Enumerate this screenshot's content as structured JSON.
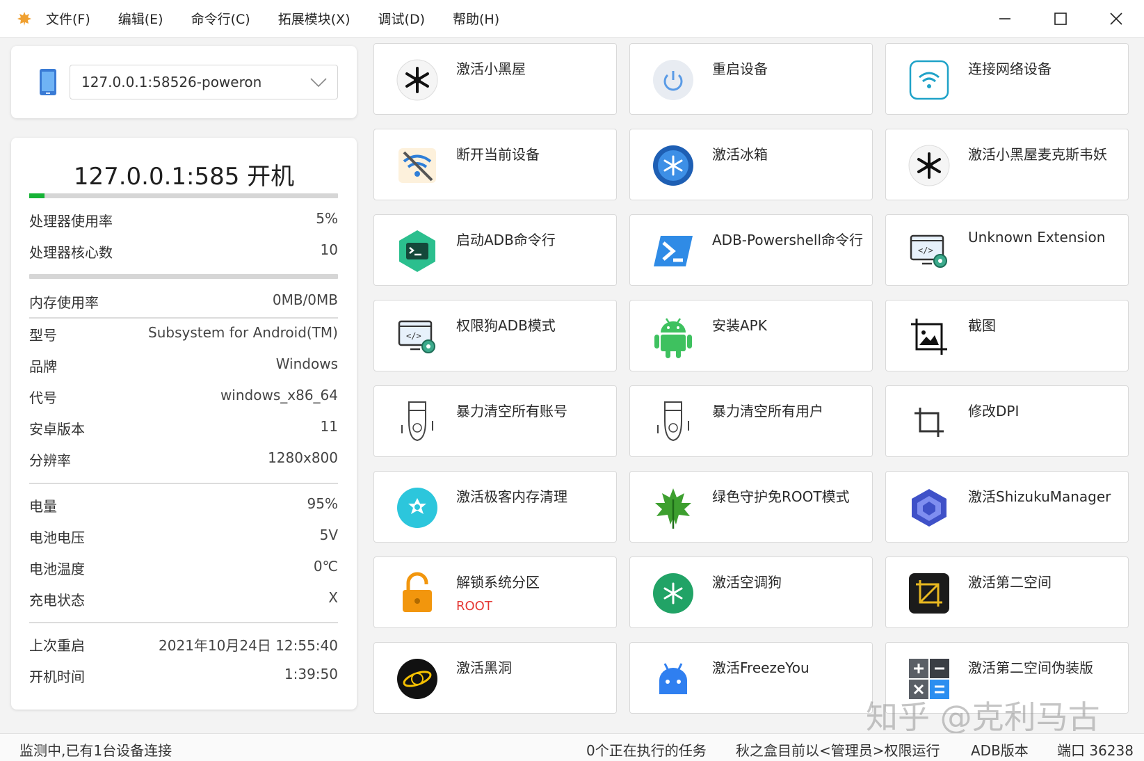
{
  "menu": {
    "items": [
      "文件(F)",
      "编辑(E)",
      "命令行(C)",
      "拓展模块(X)",
      "调试(D)",
      "帮助(H)"
    ]
  },
  "device": {
    "selected": "127.0.0.1:58526-poweron"
  },
  "info": {
    "title": "127.0.0.1:585   开机",
    "top_progress": 0.05,
    "rows_a": [
      {
        "label": "处理器使用率",
        "value": "5%"
      },
      {
        "label": "处理器核心数",
        "value": "10"
      }
    ],
    "mem_progress": 0,
    "rows_b": [
      {
        "label": "内存使用率",
        "value": "0MB/0MB"
      },
      {
        "label": "型号",
        "value": "Subsystem for Android(TM)"
      },
      {
        "label": "品牌",
        "value": "Windows"
      },
      {
        "label": "代号",
        "value": "windows_x86_64"
      },
      {
        "label": "安卓版本",
        "value": "11"
      },
      {
        "label": "分辨率",
        "value": "1280x800"
      }
    ],
    "rows_c": [
      {
        "label": "电量",
        "value": "95%"
      },
      {
        "label": "电池电压",
        "value": "5V"
      },
      {
        "label": "电池温度",
        "value": "0℃"
      },
      {
        "label": "充电状态",
        "value": "X"
      }
    ],
    "rows_d": [
      {
        "label": "上次重启",
        "value": "2021年10月24日 12:55:40"
      },
      {
        "label": "开机时间",
        "value": "1:39:50"
      }
    ]
  },
  "tiles": [
    {
      "label": "激活小黑屋",
      "icon": "snowflake-black-icon"
    },
    {
      "label": "重启设备",
      "icon": "power-icon"
    },
    {
      "label": "连接网络设备",
      "icon": "wifi-icon"
    },
    {
      "label": "断开当前设备",
      "icon": "wifi-off-icon"
    },
    {
      "label": "激活冰箱",
      "icon": "icebox-icon"
    },
    {
      "label": "激活小黑屋麦克斯韦妖",
      "icon": "snowflake-black-icon"
    },
    {
      "label": "启动ADB命令行",
      "icon": "terminal-icon"
    },
    {
      "label": "ADB-Powershell命令行",
      "icon": "powershell-icon"
    },
    {
      "label": "Unknown Extension",
      "icon": "code-settings-icon"
    },
    {
      "label": "权限狗ADB模式",
      "icon": "code-settings-icon"
    },
    {
      "label": "安装APK",
      "icon": "android-icon"
    },
    {
      "label": "截图",
      "icon": "screenshot-icon"
    },
    {
      "label": "暴力清空所有账号",
      "icon": "bomb-icon"
    },
    {
      "label": "暴力清空所有用户",
      "icon": "bomb-icon"
    },
    {
      "label": "修改DPI",
      "icon": "crop-icon"
    },
    {
      "label": "激活极客内存清理",
      "icon": "geek-cleaner-icon"
    },
    {
      "label": "绿色守护免ROOT模式",
      "icon": "greenify-leaf-icon"
    },
    {
      "label": "激活ShizukuManager",
      "icon": "shizuku-icon"
    },
    {
      "label": "解锁系统分区",
      "sub": "ROOT",
      "icon": "unlock-icon"
    },
    {
      "label": "激活空调狗",
      "icon": "aircon-dog-icon"
    },
    {
      "label": "激活第二空间",
      "icon": "second-space-icon"
    },
    {
      "label": "激活黑洞",
      "icon": "blackhole-icon"
    },
    {
      "label": "激活FreezeYou",
      "icon": "freezeyou-icon"
    },
    {
      "label": "激活第二空间伪装版",
      "icon": "calculator-icon"
    }
  ],
  "status": {
    "left": "监测中,已有1台设备连接",
    "tasks": "0个正在执行的任务",
    "admin": "秋之盒目前以<管理员>权限运行",
    "adb": "ADB版本",
    "port": "端口 36238"
  },
  "watermark": "知乎 @克利马古",
  "colors": {
    "progress_green": "#16b336",
    "root_red": "#e53935"
  }
}
